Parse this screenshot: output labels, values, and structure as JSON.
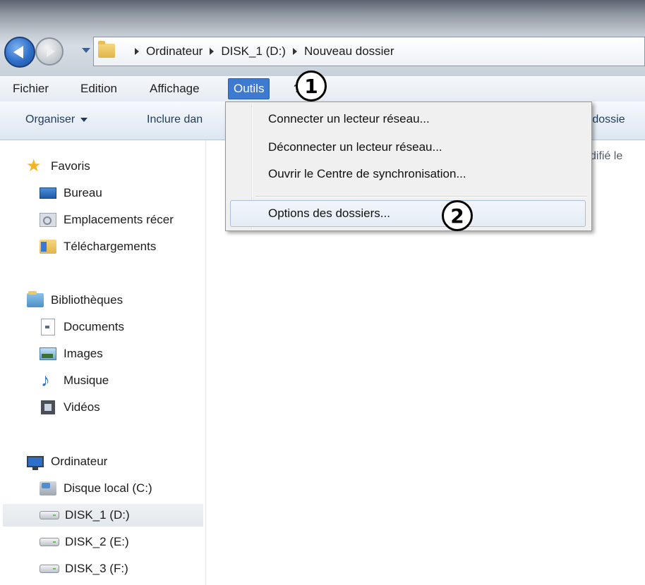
{
  "address_bar": {
    "crumbs": [
      "Ordinateur",
      "DISK_1 (D:)",
      "Nouveau dossier"
    ]
  },
  "menubar": {
    "fichier": "Fichier",
    "edition": "Edition",
    "affichage": "Affichage",
    "outils": "Outils",
    "aide_partial": "?"
  },
  "toolbar": {
    "organiser": "Organiser",
    "inclure": "Inclure dan",
    "right_partial": "u dossie"
  },
  "content": {
    "column_header_partial": "difié le"
  },
  "outils_menu": {
    "items": [
      "Connecter un lecteur réseau...",
      "Déconnecter un lecteur réseau...",
      "Ouvrir le Centre de synchronisation...",
      "Options des dossiers..."
    ]
  },
  "callouts": [
    "1",
    "2"
  ],
  "navpane": {
    "favoris": {
      "header": "Favoris",
      "items": [
        "Bureau",
        "Emplacements récer",
        "Téléchargements"
      ]
    },
    "bibliotheques": {
      "header": "Bibliothèques",
      "items": [
        "Documents",
        "Images",
        "Musique",
        "Vidéos"
      ]
    },
    "ordinateur": {
      "header": "Ordinateur",
      "items": [
        "Disque local (C:)",
        "DISK_1 (D:)",
        "DISK_2 (E:)",
        "DISK_3 (F:)"
      ],
      "selected": "DISK_1 (D:)"
    }
  },
  "colors": {
    "menu_active_bg": "#3d7bd3",
    "hover_border": "#a9c0dc",
    "selected_row_bg": "#e6eaee"
  }
}
